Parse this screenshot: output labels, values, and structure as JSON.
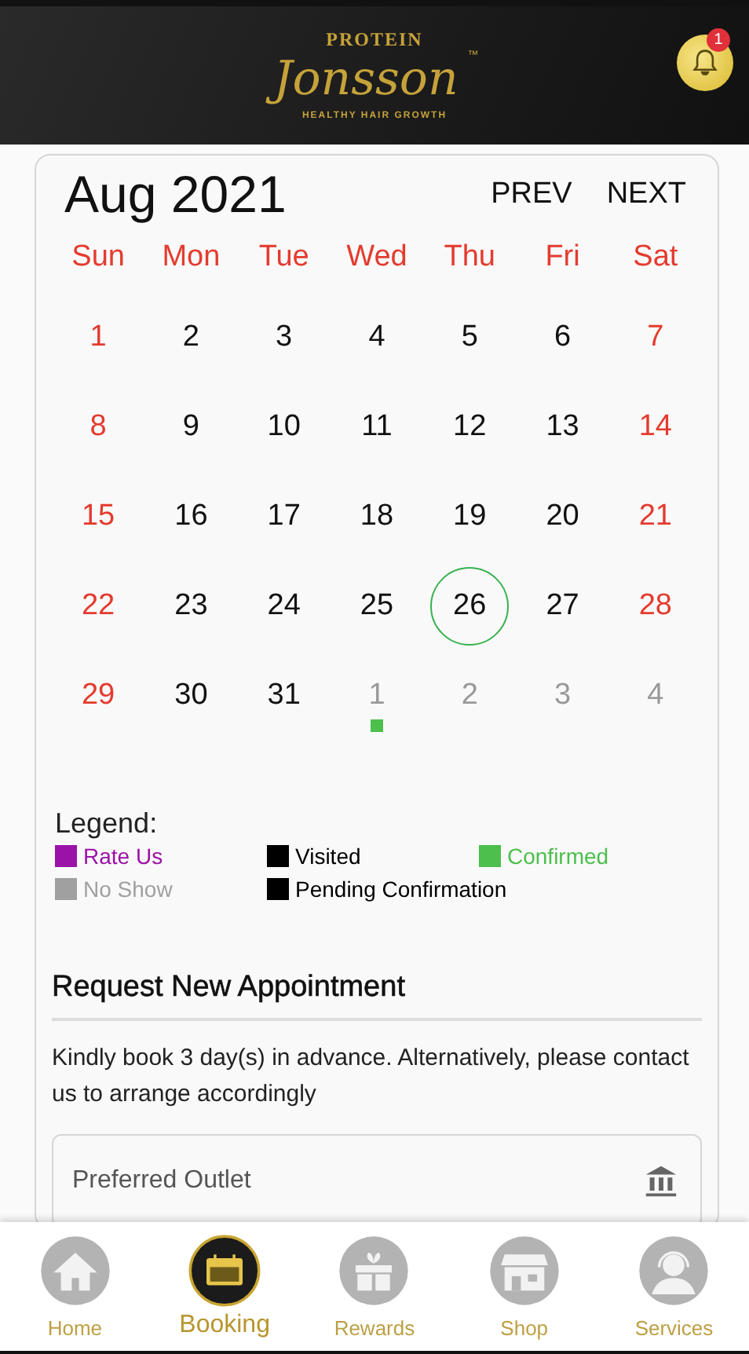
{
  "header": {
    "logo": {
      "top": "PROTEIN",
      "main": "Jonsson",
      "tm": "™",
      "bottom": "HEALTHY HAIR GROWTH"
    },
    "notification_badge": "1"
  },
  "calendar": {
    "month": "Aug 2021",
    "prev": "PREV",
    "next": "NEXT",
    "weekdays": [
      {
        "label": "Sun"
      },
      {
        "label": "Mon"
      },
      {
        "label": "Tue"
      },
      {
        "label": "Wed"
      },
      {
        "label": "Thu"
      },
      {
        "label": "Fri"
      },
      {
        "label": "Sat"
      }
    ],
    "weeks": [
      [
        {
          "day": "1",
          "weekend": true,
          "muted": false,
          "today": false
        },
        {
          "day": "2",
          "weekend": false,
          "muted": false,
          "today": false
        },
        {
          "day": "3",
          "weekend": false,
          "muted": false,
          "today": false
        },
        {
          "day": "4",
          "weekend": false,
          "muted": false,
          "today": false
        },
        {
          "day": "5",
          "weekend": false,
          "muted": false,
          "today": false
        },
        {
          "day": "6",
          "weekend": false,
          "muted": false,
          "today": false
        },
        {
          "day": "7",
          "weekend": true,
          "muted": false,
          "today": false
        }
      ],
      [
        {
          "day": "8",
          "weekend": true,
          "muted": false,
          "today": false
        },
        {
          "day": "9",
          "weekend": false,
          "muted": false,
          "today": false
        },
        {
          "day": "10",
          "weekend": false,
          "muted": false,
          "today": false
        },
        {
          "day": "11",
          "weekend": false,
          "muted": false,
          "today": false
        },
        {
          "day": "12",
          "weekend": false,
          "muted": false,
          "today": false
        },
        {
          "day": "13",
          "weekend": false,
          "muted": false,
          "today": false
        },
        {
          "day": "14",
          "weekend": true,
          "muted": false,
          "today": false
        }
      ],
      [
        {
          "day": "15",
          "weekend": true,
          "muted": false,
          "today": false
        },
        {
          "day": "16",
          "weekend": false,
          "muted": false,
          "today": false
        },
        {
          "day": "17",
          "weekend": false,
          "muted": false,
          "today": false
        },
        {
          "day": "18",
          "weekend": false,
          "muted": false,
          "today": false
        },
        {
          "day": "19",
          "weekend": false,
          "muted": false,
          "today": false
        },
        {
          "day": "20",
          "weekend": false,
          "muted": false,
          "today": false
        },
        {
          "day": "21",
          "weekend": true,
          "muted": false,
          "today": false
        }
      ],
      [
        {
          "day": "22",
          "weekend": true,
          "muted": false,
          "today": false
        },
        {
          "day": "23",
          "weekend": false,
          "muted": false,
          "today": false
        },
        {
          "day": "24",
          "weekend": false,
          "muted": false,
          "today": false
        },
        {
          "day": "25",
          "weekend": false,
          "muted": false,
          "today": false
        },
        {
          "day": "26",
          "weekend": false,
          "muted": false,
          "today": true
        },
        {
          "day": "27",
          "weekend": false,
          "muted": false,
          "today": false
        },
        {
          "day": "28",
          "weekend": true,
          "muted": false,
          "today": false
        }
      ],
      [
        {
          "day": "29",
          "weekend": true,
          "muted": false,
          "today": false
        },
        {
          "day": "30",
          "weekend": false,
          "muted": false,
          "today": false
        },
        {
          "day": "31",
          "weekend": false,
          "muted": false,
          "today": false
        },
        {
          "day": "1",
          "muted": true,
          "today": false,
          "color": "#4cbf4c"
        },
        {
          "day": "2",
          "muted": true,
          "today": false
        },
        {
          "day": "3",
          "muted": true,
          "today": false
        },
        {
          "day": "4",
          "muted": true,
          "today": false
        }
      ]
    ]
  },
  "legend": {
    "title": "Legend:",
    "items": [
      {
        "label": "Rate Us",
        "color": "#9b12a8"
      },
      {
        "label": "Visited",
        "color": "#000000"
      },
      {
        "label": "Confirmed",
        "color": "#4cbf4c"
      },
      {
        "label": "No Show",
        "color": "#a0a0a0"
      },
      {
        "label": "Pending Confirmation",
        "color": "#000000"
      }
    ]
  },
  "request": {
    "title": "Request New Appointment",
    "note": "Kindly book 3 day(s) in advance. Alternatively, please contact us to arrange accordingly",
    "outlet_field": {
      "placeholder": "Preferred Outlet"
    }
  },
  "nav": [
    {
      "label": "Home",
      "selected": false
    },
    {
      "label": "Booking",
      "selected": true
    },
    {
      "label": "Rewards",
      "selected": false
    },
    {
      "label": "Shop",
      "selected": false
    },
    {
      "label": "Services",
      "selected": false
    }
  ]
}
